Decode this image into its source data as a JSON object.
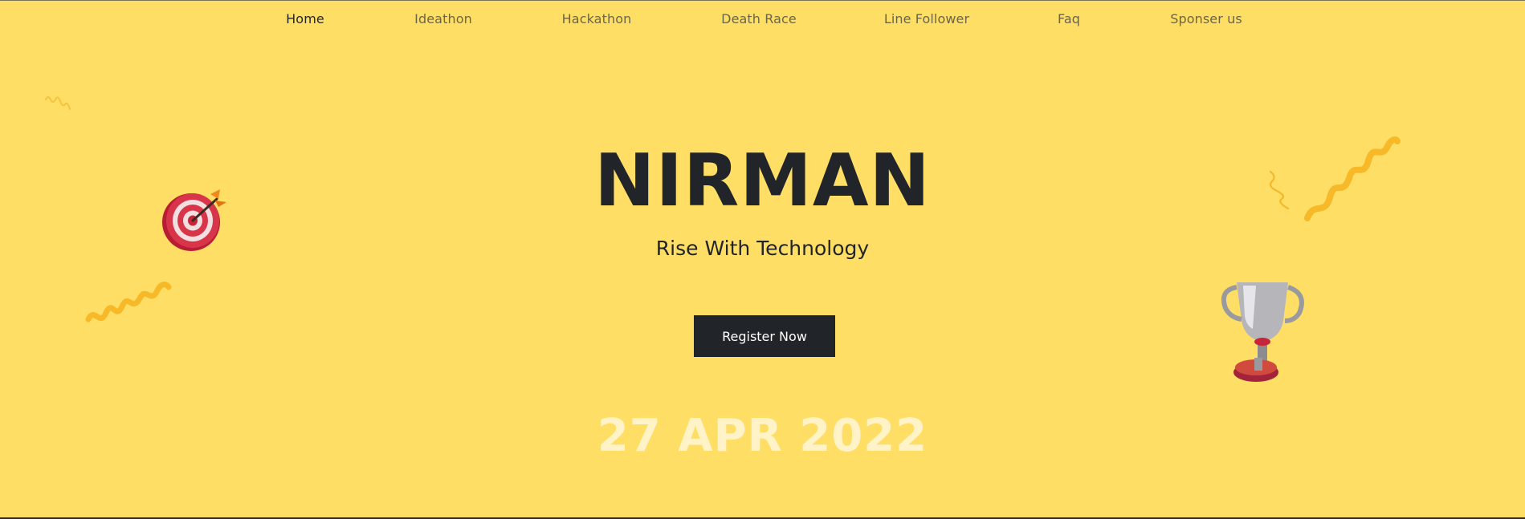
{
  "nav": {
    "items": [
      {
        "label": "Home",
        "active": true
      },
      {
        "label": "Ideathon",
        "active": false
      },
      {
        "label": "Hackathon",
        "active": false
      },
      {
        "label": "Death Race",
        "active": false
      },
      {
        "label": "Line Follower",
        "active": false
      },
      {
        "label": "Faq",
        "active": false
      },
      {
        "label": "Sponser us",
        "active": false
      }
    ]
  },
  "hero": {
    "title": "NIRMAN",
    "subtitle": "Rise With Technology",
    "register_label": "Register Now",
    "date": "27 APR 2022"
  },
  "icons": {
    "target": "target-icon",
    "trophy": "trophy-icon",
    "squiggles": "squiggle-icon"
  },
  "colors": {
    "background": "#ffde66",
    "text_dark": "#212529",
    "nav_inactive": "#6b6544",
    "date_text": "#fff3c7",
    "button_bg": "#212529",
    "squiggle": "#f7b928",
    "target_red": "#c8243a",
    "trophy_silver": "#a9a9ad"
  }
}
